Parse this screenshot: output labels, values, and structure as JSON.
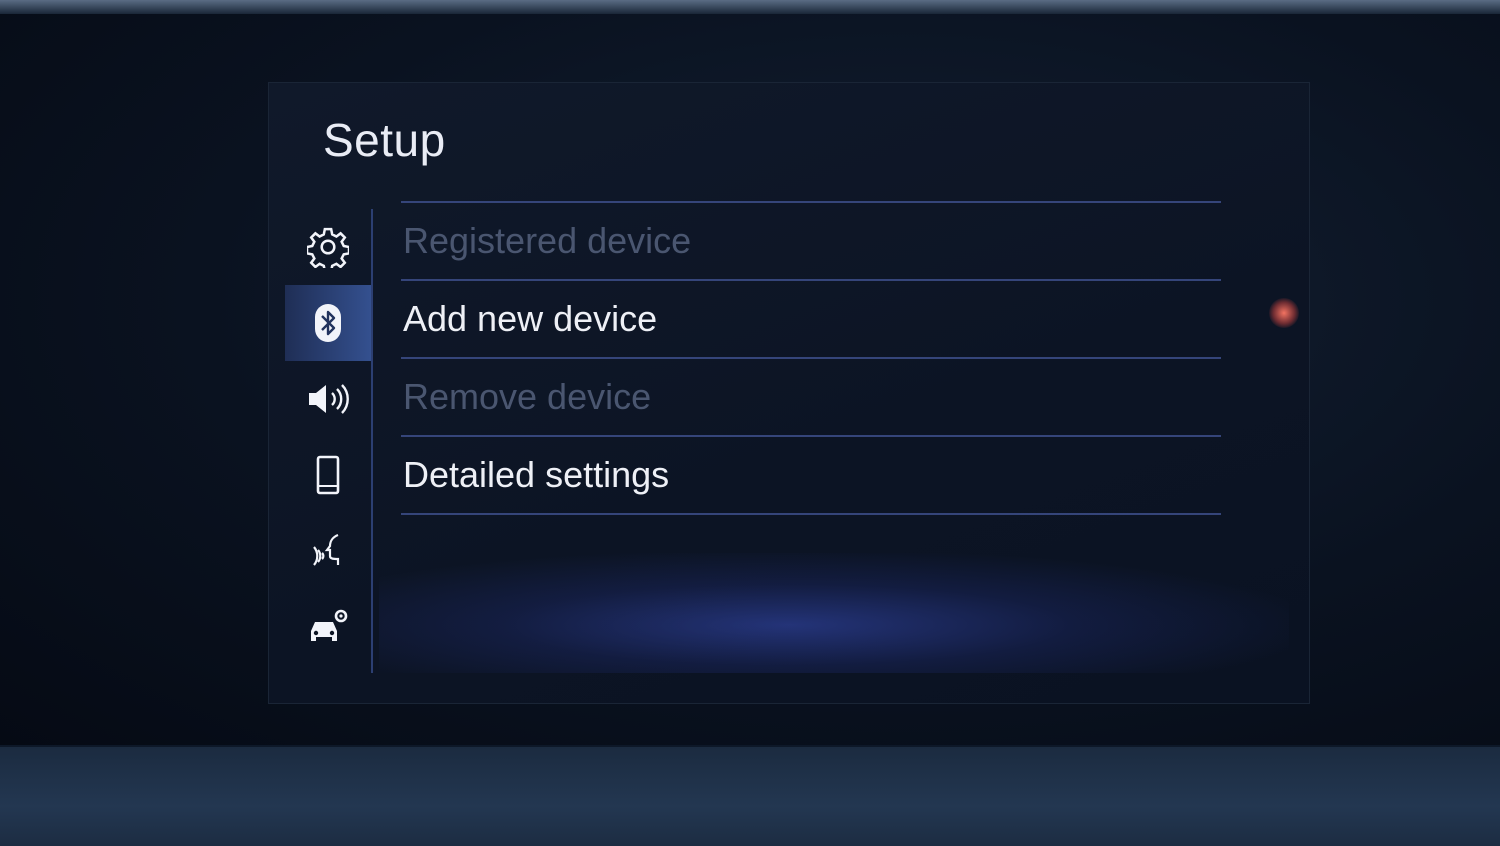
{
  "screen": {
    "title": "Setup"
  },
  "sidebar": {
    "items": [
      {
        "icon": "gear-icon",
        "name": "general-settings",
        "active": false
      },
      {
        "icon": "bluetooth-icon",
        "name": "bluetooth",
        "active": true
      },
      {
        "icon": "speaker-icon",
        "name": "audio",
        "active": false
      },
      {
        "icon": "phone-icon",
        "name": "phone",
        "active": false
      },
      {
        "icon": "voice-icon",
        "name": "voice",
        "active": false
      },
      {
        "icon": "car-settings-icon",
        "name": "vehicle",
        "active": false
      }
    ]
  },
  "menu": {
    "items": [
      {
        "label": "Registered device",
        "enabled": false
      },
      {
        "label": "Add new device",
        "enabled": true
      },
      {
        "label": "Remove device",
        "enabled": false
      },
      {
        "label": "Detailed settings",
        "enabled": true
      }
    ]
  },
  "colors": {
    "accent": "#34508f",
    "divider": "#35457a",
    "text_enabled": "#eef0f6",
    "text_disabled": "#4a5670"
  }
}
